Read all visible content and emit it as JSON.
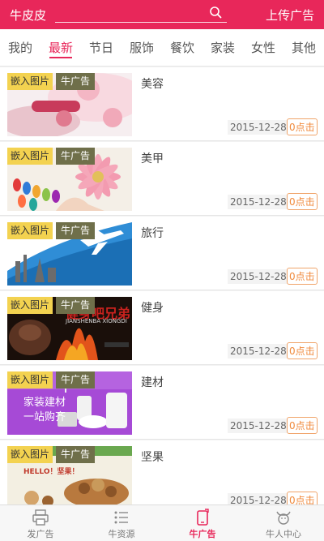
{
  "header": {
    "app_name": "牛皮皮",
    "search_placeholder": "",
    "upload_label": "上传广告"
  },
  "tabs": [
    {
      "label": "我的"
    },
    {
      "label": "最新",
      "active": true
    },
    {
      "label": "节日"
    },
    {
      "label": "服饰"
    },
    {
      "label": "餐饮"
    },
    {
      "label": "家装"
    },
    {
      "label": "女性"
    },
    {
      "label": "其他"
    }
  ],
  "list": {
    "items": [
      {
        "badge1": "嵌入图片",
        "badge2": "牛广告",
        "title": "美容",
        "date": "2015-12-28",
        "clicks": "0点击"
      },
      {
        "badge1": "嵌入图片",
        "badge2": "牛广告",
        "title": "美甲",
        "date": "2015-12-28",
        "clicks": "0点击"
      },
      {
        "badge1": "嵌入图片",
        "badge2": "牛广告",
        "title": "旅行",
        "date": "2015-12-28",
        "clicks": "0点击"
      },
      {
        "badge1": "嵌入图片",
        "badge2": "牛广告",
        "title": "健身",
        "date": "2015-12-28",
        "clicks": "0点击",
        "image_text": {
          "main": "健身吧兄弟",
          "sub": "JIANSHENBA XIONGDI"
        }
      },
      {
        "badge1": "嵌入图片",
        "badge2": "牛广告",
        "title": "建材",
        "date": "2015-12-28",
        "clicks": "0点击",
        "image_text": {
          "line1": "家装建材",
          "line2": "一站购齐"
        }
      },
      {
        "badge1": "嵌入图片",
        "badge2": "牛广告",
        "title": "坚果",
        "date": "2015-12-28",
        "clicks": "0点击",
        "image_text": {
          "main": "HELLO！坚果！"
        }
      }
    ]
  },
  "bottom_nav": [
    {
      "label": "发广告",
      "icon": "printer-icon"
    },
    {
      "label": "牛资源",
      "icon": "list-icon"
    },
    {
      "label": "牛广告",
      "icon": "phone-ad-icon",
      "active": true
    },
    {
      "label": "牛人中心",
      "icon": "bull-head-icon"
    }
  ],
  "colors": {
    "brand": "#e8275a",
    "badge_yellow": "#f3d250",
    "badge_olive": "#6f6f4a",
    "clicks_orange": "#f08a3c"
  }
}
